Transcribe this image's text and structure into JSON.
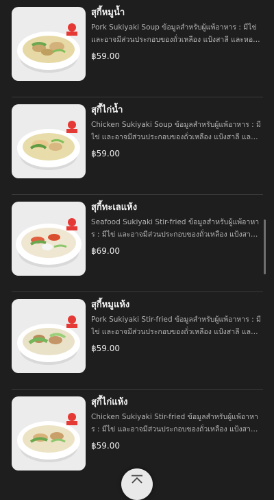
{
  "menu": {
    "items": [
      {
        "name": "สุกี้หมูน้ำ",
        "description": "Pork Sukiyaki Soup ข้อมูลสำหรับผู้แพ้อาหาร : มีไข่ และอาจมีส่วนประกอบของถั่วเหลือง แป้งสาลี และหอยนางรม",
        "price": "฿59.00",
        "image_icon": "pork-sukiyaki-soup-image"
      },
      {
        "name": "สุกี้ไก่น้ำ",
        "description": "Chicken Sukiyaki Soup ข้อมูลสำหรับผู้แพ้อาหาร : มีไข่ และอาจมีส่วนประกอบของถั่วเหลือง แป้งสาลี และหอยนางรม",
        "price": "฿59.00",
        "image_icon": "chicken-sukiyaki-soup-image"
      },
      {
        "name": "สุกี้ทะเลแห้ง",
        "description": "Seafood Sukiyaki Stir-fried ข้อมูลสำหรับผู้แพ้อาหาร : มีไข่ และอาจมีส่วนประกอบของถั่วเหลือง แป้งสาลี และหอยนางรม",
        "price": "฿69.00",
        "image_icon": "seafood-sukiyaki-stir-fried-image"
      },
      {
        "name": "สุกี้หมูแห้ง",
        "description": "Pork Sukiyaki Stir-fried ข้อมูลสำหรับผู้แพ้อาหาร : มีไข่ และอาจมีส่วนประกอบของถั่วเหลือง แป้งสาลี และหอยนางรม",
        "price": "฿59.00",
        "image_icon": "pork-sukiyaki-stir-fried-image"
      },
      {
        "name": "สุกี้ไก่แห้ง",
        "description": "Chicken Sukiyaki Stir-fried ข้อมูลสำหรับผู้แพ้อาหาร : มีไข่ และอาจมีส่วนประกอบของถั่วเหลือง แป้งสาลี และหอยนางรม",
        "price": "฿59.00",
        "image_icon": "chicken-sukiyaki-stir-fried-image"
      }
    ]
  },
  "controls": {
    "scroll_top_icon": "chevron-up-icon"
  },
  "colors": {
    "background": "#1e1e1e",
    "title_text": "#f2f2f2",
    "description_text": "#b3b3b3",
    "divider": "#3a3a3a"
  }
}
